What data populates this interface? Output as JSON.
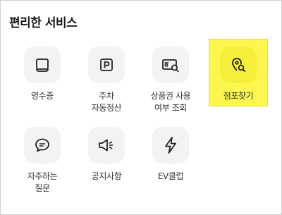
{
  "section": {
    "title": "편리한 서비스"
  },
  "services": [
    {
      "id": "receipt",
      "label": "영수증",
      "icon": "receipt-icon"
    },
    {
      "id": "parking",
      "label": "주차\n자동정산",
      "icon": "parking-icon"
    },
    {
      "id": "voucher",
      "label": "상품권 사용\n여부 조회",
      "icon": "voucher-search-icon"
    },
    {
      "id": "store",
      "label": "점포찾기",
      "icon": "location-search-icon",
      "highlighted": true
    },
    {
      "id": "faq",
      "label": "자주하는\n질문",
      "icon": "chat-bubble-icon"
    },
    {
      "id": "notice",
      "label": "공지사항",
      "icon": "megaphone-icon"
    },
    {
      "id": "ev",
      "label": "EV클럽",
      "icon": "lightning-icon"
    }
  ],
  "colors": {
    "highlight": "#fbf74f",
    "tile_bg": "#f3f3f3",
    "icon_stroke": "#222222"
  }
}
